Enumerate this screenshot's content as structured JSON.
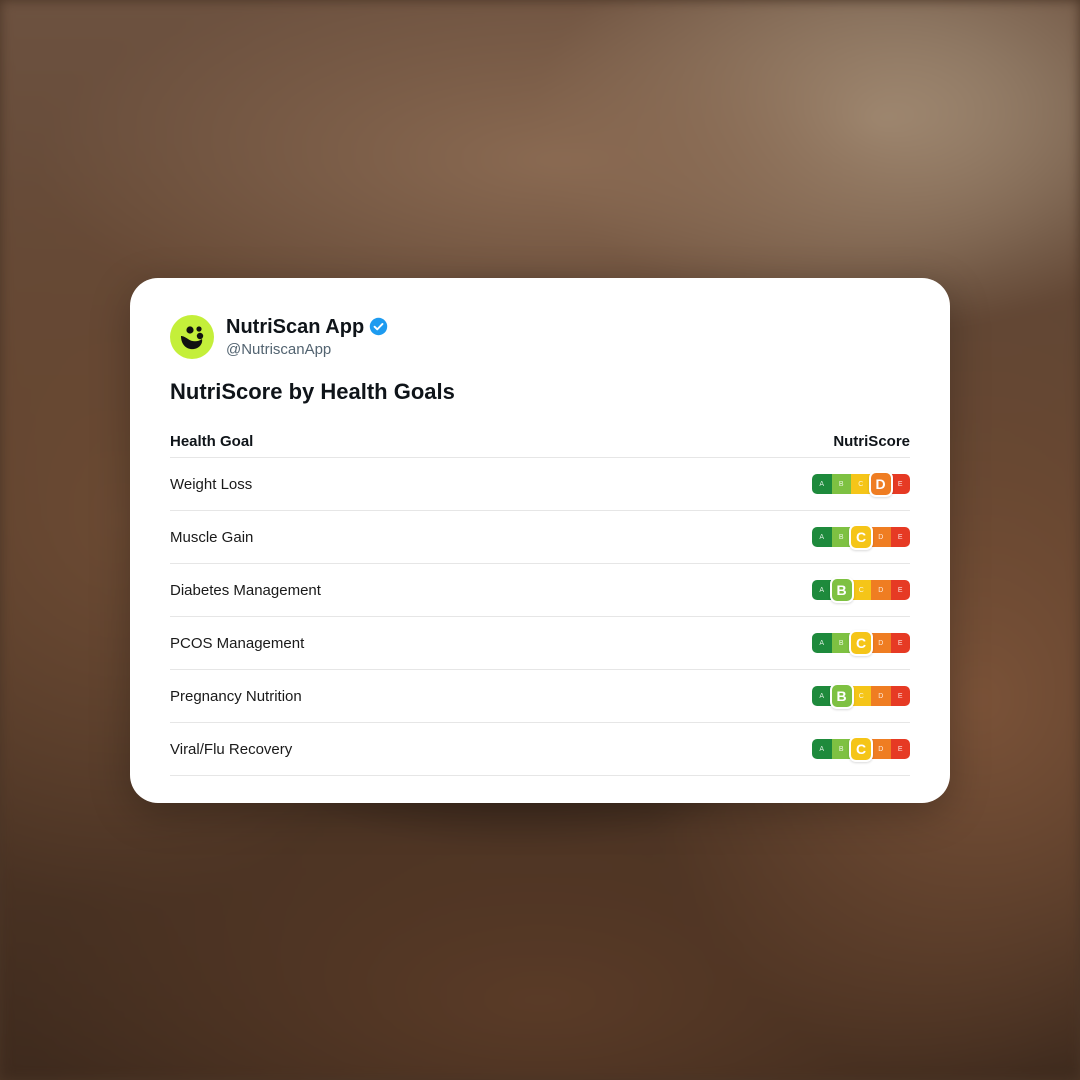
{
  "account": {
    "name": "NutriScan App",
    "handle": "@NutriscanApp",
    "verified": true
  },
  "post": {
    "title": "NutriScore by Health Goals"
  },
  "table": {
    "headers": {
      "goal": "Health Goal",
      "score": "NutriScore"
    },
    "grades": [
      "A",
      "B",
      "C",
      "D",
      "E"
    ],
    "grade_colors": {
      "A": "#1e8a3c",
      "B": "#7ec142",
      "C": "#f5c518",
      "D": "#ef7d22",
      "E": "#e63a24"
    },
    "rows": [
      {
        "goal": "Weight Loss",
        "score": "D"
      },
      {
        "goal": "Muscle Gain",
        "score": "C"
      },
      {
        "goal": "Diabetes Management",
        "score": "B"
      },
      {
        "goal": "PCOS Management",
        "score": "C"
      },
      {
        "goal": "Pregnancy Nutrition",
        "score": "B"
      },
      {
        "goal": "Viral/Flu Recovery",
        "score": "C"
      }
    ]
  },
  "colors": {
    "verified_badge": "#1d9bf0",
    "avatar_bg": "#c4ef3a"
  }
}
